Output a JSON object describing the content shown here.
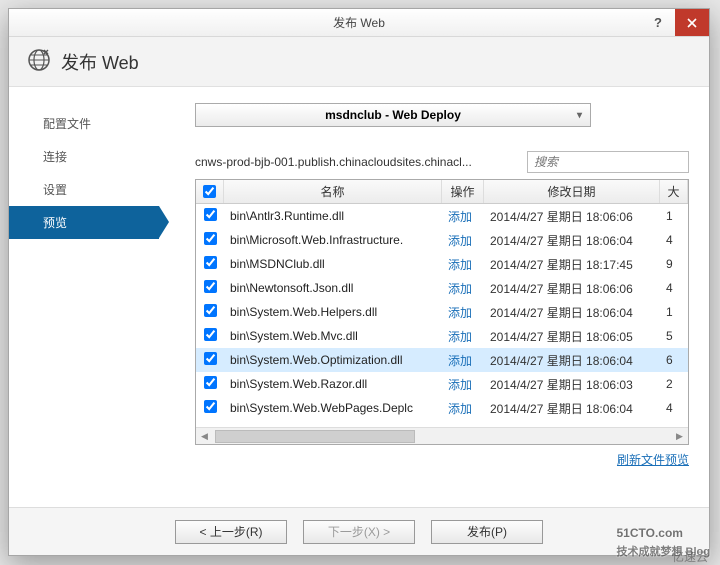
{
  "window": {
    "title": "发布 Web"
  },
  "header": {
    "title": "发布 Web"
  },
  "sidebar": {
    "items": [
      {
        "label": "配置文件"
      },
      {
        "label": "连接"
      },
      {
        "label": "设置"
      },
      {
        "label": "预览"
      }
    ],
    "activeIndex": 3
  },
  "main": {
    "profile": "msdnclub - Web Deploy",
    "path": "cnws-prod-bjb-001.publish.chinacloudsites.chinacl...",
    "search_placeholder": "搜索",
    "columns": {
      "name": "名称",
      "op": "操作",
      "date": "修改日期",
      "size": "大"
    },
    "rows": [
      {
        "chk": true,
        "name": "bin\\Antlr3.Runtime.dll",
        "op": "添加",
        "date": "2014/4/27 星期日 18:06:06",
        "size": "1"
      },
      {
        "chk": true,
        "name": "bin\\Microsoft.Web.Infrastructure.",
        "op": "添加",
        "date": "2014/4/27 星期日 18:06:04",
        "size": "4"
      },
      {
        "chk": true,
        "name": "bin\\MSDNClub.dll",
        "op": "添加",
        "date": "2014/4/27 星期日 18:17:45",
        "size": "9"
      },
      {
        "chk": true,
        "name": "bin\\Newtonsoft.Json.dll",
        "op": "添加",
        "date": "2014/4/27 星期日 18:06:06",
        "size": "4"
      },
      {
        "chk": true,
        "name": "bin\\System.Web.Helpers.dll",
        "op": "添加",
        "date": "2014/4/27 星期日 18:06:04",
        "size": "1"
      },
      {
        "chk": true,
        "name": "bin\\System.Web.Mvc.dll",
        "op": "添加",
        "date": "2014/4/27 星期日 18:06:05",
        "size": "5"
      },
      {
        "chk": true,
        "name": "bin\\System.Web.Optimization.dll",
        "op": "添加",
        "date": "2014/4/27 星期日 18:06:04",
        "size": "6",
        "selected": true
      },
      {
        "chk": true,
        "name": "bin\\System.Web.Razor.dll",
        "op": "添加",
        "date": "2014/4/27 星期日 18:06:03",
        "size": "2"
      },
      {
        "chk": true,
        "name": "bin\\System.Web.WebPages.Deplc",
        "op": "添加",
        "date": "2014/4/27 星期日 18:06:04",
        "size": "4"
      }
    ],
    "refresh_label": "刷新文件预览"
  },
  "footer": {
    "prev": "< 上一步(R)",
    "next": "下一步(X) >",
    "publish": "发布(P)"
  },
  "watermark": {
    "main": "51CTO.com",
    "sub1": "技术成就梦想 Blog",
    "sub2": "亿速云"
  }
}
